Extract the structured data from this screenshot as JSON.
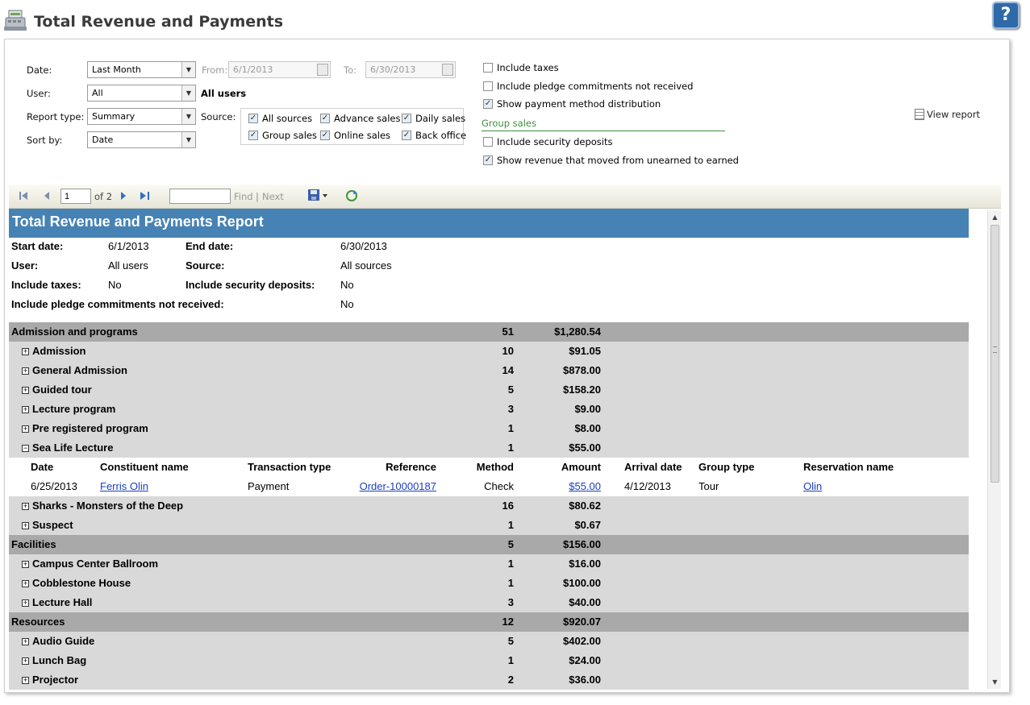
{
  "app": {
    "title": "Total Revenue and Payments",
    "help_label": "?"
  },
  "params": {
    "date_label": "Date:",
    "date_value": "Last Month",
    "from_label": "From:",
    "from_value": "6/1/2013",
    "to_label": "To:",
    "to_value": "6/30/2013",
    "user_label": "User:",
    "user_value": "All",
    "user_display": "All users",
    "report_type_label": "Report type:",
    "report_type_value": "Summary",
    "sort_label": "Sort by:",
    "sort_value": "Date",
    "source_label": "Source:",
    "sources": [
      {
        "label": "All sources",
        "checked": true
      },
      {
        "label": "Advance sales",
        "checked": true
      },
      {
        "label": "Daily sales",
        "checked": true
      },
      {
        "label": "Group sales",
        "checked": true
      },
      {
        "label": "Online sales",
        "checked": true
      },
      {
        "label": "Back office",
        "checked": true
      }
    ],
    "options": [
      {
        "label": "Include taxes",
        "checked": false
      },
      {
        "label": "Include pledge commitments not received",
        "checked": false
      },
      {
        "label": "Show payment method distribution",
        "checked": true
      }
    ],
    "group_sales_heading": "Group sales",
    "group_options": [
      {
        "label": "Include security deposits",
        "checked": false
      },
      {
        "label": "Show revenue that moved from unearned to earned",
        "checked": true
      }
    ],
    "view_report_label": "View report"
  },
  "toolbar": {
    "page": "1",
    "of_pages": "of 2",
    "find_label": "Find",
    "separator": "|",
    "next_label": "Next"
  },
  "report": {
    "title": "Total Revenue and Payments Report",
    "info": {
      "start_date_label": "Start date:",
      "start_date": "6/1/2013",
      "end_date_label": "End date:",
      "end_date": "6/30/2013",
      "user_label": "User:",
      "user": "All users",
      "source_label": "Source:",
      "source": "All sources",
      "taxes_label": "Include taxes:",
      "taxes": "No",
      "security_label": "Include security deposits:",
      "security": "No",
      "pledge_label": "Include pledge commitments not received:",
      "pledge": "No"
    },
    "detail_headers": {
      "date": "Date",
      "constituent": "Constituent name",
      "transaction_type": "Transaction type",
      "reference": "Reference",
      "method": "Method",
      "amount": "Amount",
      "arrival_date": "Arrival date",
      "group_type": "Group type",
      "reservation_name": "Reservation name"
    },
    "detail": {
      "date": "6/25/2013",
      "constituent": "Ferris Olin",
      "transaction_type": "Payment",
      "reference": "Order-10000187",
      "method": "Check",
      "amount": "$55.00",
      "arrival_date": "4/12/2013",
      "group_type": "Tour",
      "reservation_name": "Olin"
    },
    "rows": [
      {
        "type": "cat",
        "name": "Admission and programs",
        "count": "51",
        "amount": "$1,280.54"
      },
      {
        "type": "sub",
        "name": "Admission",
        "count": "10",
        "amount": "$91.05",
        "toggle": "+"
      },
      {
        "type": "sub",
        "name": "General Admission",
        "count": "14",
        "amount": "$878.00",
        "toggle": "+"
      },
      {
        "type": "sub",
        "name": "Guided tour",
        "count": "5",
        "amount": "$158.20",
        "toggle": "+"
      },
      {
        "type": "sub",
        "name": "Lecture program",
        "count": "3",
        "amount": "$9.00",
        "toggle": "+"
      },
      {
        "type": "sub",
        "name": "Pre registered program",
        "count": "1",
        "amount": "$8.00",
        "toggle": "+"
      },
      {
        "type": "sub",
        "name": "Sea Life Lecture",
        "count": "1",
        "amount": "$55.00",
        "toggle": "−"
      },
      {
        "type": "hdr"
      },
      {
        "type": "det"
      },
      {
        "type": "sub",
        "name": "Sharks - Monsters of the Deep",
        "count": "16",
        "amount": "$80.62",
        "toggle": "+"
      },
      {
        "type": "sub",
        "name": "Suspect",
        "count": "1",
        "amount": "$0.67",
        "toggle": "+"
      },
      {
        "type": "cat",
        "name": "Facilities",
        "count": "5",
        "amount": "$156.00"
      },
      {
        "type": "sub",
        "name": "Campus Center Ballroom",
        "count": "1",
        "amount": "$16.00",
        "toggle": "+"
      },
      {
        "type": "sub",
        "name": "Cobblestone House",
        "count": "1",
        "amount": "$100.00",
        "toggle": "+"
      },
      {
        "type": "sub",
        "name": "Lecture Hall",
        "count": "3",
        "amount": "$40.00",
        "toggle": "+"
      },
      {
        "type": "cat",
        "name": "Resources",
        "count": "12",
        "amount": "$920.07"
      },
      {
        "type": "sub",
        "name": "Audio Guide",
        "count": "5",
        "amount": "$402.00",
        "toggle": "+"
      },
      {
        "type": "sub",
        "name": "Lunch Bag",
        "count": "1",
        "amount": "$24.00",
        "toggle": "+"
      },
      {
        "type": "sub",
        "name": "Projector",
        "count": "2",
        "amount": "$36.00",
        "toggle": "+"
      }
    ]
  }
}
